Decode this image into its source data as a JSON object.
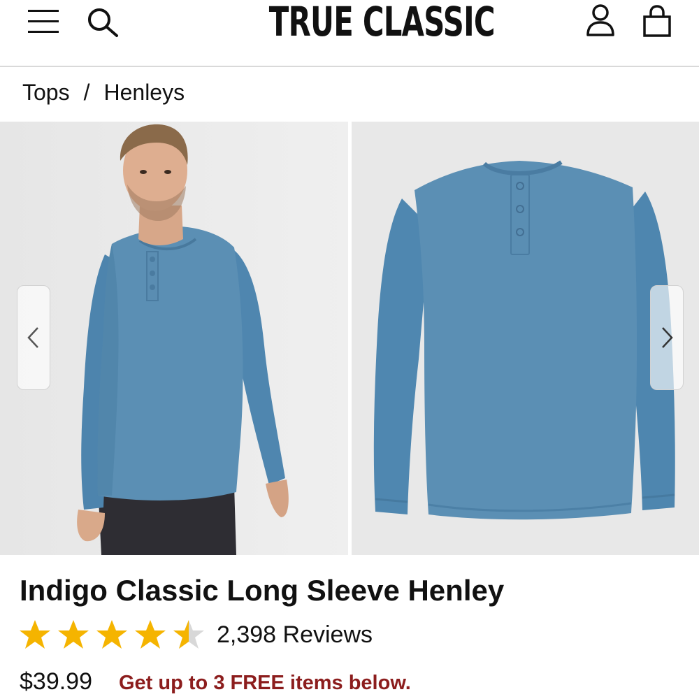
{
  "header": {
    "logo": "TRUE CLASSIC",
    "icons": [
      "menu-icon",
      "search-icon",
      "account-icon",
      "shopping-bag-icon"
    ]
  },
  "breadcrumb": {
    "items": [
      "Tops",
      "Henleys"
    ],
    "separator": "/"
  },
  "gallery": {
    "images": [
      "model-wearing-henley",
      "henley-product-flat"
    ],
    "shirt_color": "#5b8fb4"
  },
  "product": {
    "title": "Indigo Classic Long Sleeve Henley",
    "rating": 4.5,
    "reviews_label": "2,398 Reviews",
    "price": "$39.99",
    "promo": "Get up to 3 FREE items below.",
    "star_color": "#f5b400",
    "promo_color": "#8c1d1d"
  }
}
